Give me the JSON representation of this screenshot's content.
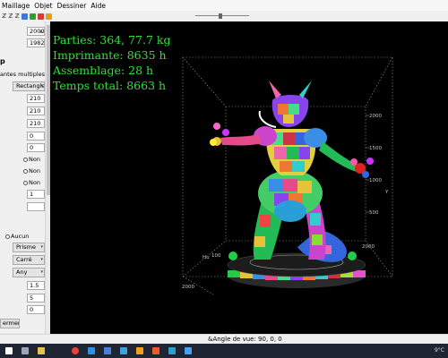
{
  "menu": [
    "Maillage",
    "Objet",
    "Dessiner",
    "Aide"
  ],
  "toolbar_glyphs": [
    "ℤ",
    "ℤ",
    "ℤ"
  ],
  "left_panel": {
    "field_2000": "2000",
    "field_1982": "1982",
    "section_letter": "p",
    "heading": "antes multiples",
    "shape_select": "Rectangle",
    "dims": [
      "210",
      "210",
      "210",
      "0",
      "0"
    ],
    "radio_non": [
      "Non",
      "Non",
      "Non"
    ],
    "field_1": "1",
    "field_blank": "",
    "radio_aucun": "Aucun",
    "select_prisme": "Prisme",
    "select_carre": "Carré",
    "select_any": "Any",
    "val_15": "1.5",
    "val_5": "5",
    "val_0": "0",
    "close_button": "ermer"
  },
  "viewport": {
    "stats": [
      "Parties: 364, 77.7 kg",
      "Imprimante: 8635 h",
      "Assemblage: 28 h",
      "Temps total: 8663 h"
    ],
    "axis_ticks": {
      "z_2000": "2000",
      "z_1500": "1500",
      "z_1000": "1000",
      "z_500": "500",
      "y_label": "Y",
      "x_2000": "2000",
      "x_100": "100",
      "x_hu": "Hu",
      "bottom_2000": "2000"
    },
    "colors": {
      "background": "#000000",
      "stats_text": "#2fe13a",
      "grid": "#9a9a9a"
    }
  },
  "status_bar": {
    "text": "&Angle de vue: 90, 0, 0"
  },
  "taskbar": {
    "tray_text": "9°C"
  }
}
